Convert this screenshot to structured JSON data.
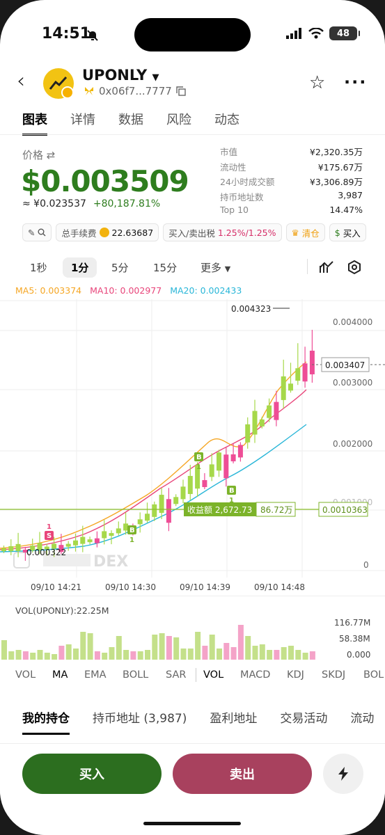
{
  "status_bar": {
    "time": "14:51",
    "battery": "48"
  },
  "header": {
    "token_name": "UPONLY",
    "address": "0x06f7...7777"
  },
  "tabs": [
    "图表",
    "详情",
    "数据",
    "风险",
    "动态"
  ],
  "price": {
    "label": "价格",
    "value": "$0.003509",
    "cny": "≈ ¥0.023537",
    "change": "+80,187.81%"
  },
  "stats": [
    {
      "k": "市值",
      "v": "¥2,320.35万"
    },
    {
      "k": "流动性",
      "v": "¥175.67万"
    },
    {
      "k": "24小时成交额",
      "v": "¥3,306.89万"
    },
    {
      "k": "持币地址数",
      "v": "3,987"
    },
    {
      "k": "Top 10",
      "v": "14.47%"
    }
  ],
  "chips": {
    "fee_label": "总手续费",
    "fee_value": "22.63687",
    "tax_label": "买入/卖出税",
    "tax_value": "1.25%/1.25%",
    "clear_label": "清仓",
    "buy_label": "买入"
  },
  "timeframes": [
    "1秒",
    "1分",
    "5分",
    "15分",
    "更多"
  ],
  "ma_legend": {
    "ma5": "MA5: 0.003374",
    "ma10": "MA10: 0.002977",
    "ma20": "MA20: 0.002433",
    "colors": {
      "ma5": "#f5a623",
      "ma10": "#e8457a",
      "ma20": "#29b6d8"
    }
  },
  "chart_data": {
    "type": "candlestick",
    "y_ticks": [
      "0.004000",
      "0.003000",
      "0.002000",
      "0",
      "0"
    ],
    "x_ticks": [
      "09/10 14:21",
      "09/10 14:30",
      "09/10 14:39",
      "09/10 14:48"
    ],
    "annotations": {
      "high": "0.004323",
      "low": "0.000322",
      "current_price": "0.003407",
      "avg_cost": "0.0010363",
      "profit_label": "收益额 2,672.73",
      "profit_value": "86.72万",
      "watermark": "DEX"
    },
    "markers": {
      "buy": "B",
      "sell": "S",
      "count": "1"
    }
  },
  "volume": {
    "title": "VOL(UPONLY):22.25M",
    "ticks": [
      "116.77M",
      "58.38M",
      "0.000"
    ]
  },
  "indicators": [
    "VOL",
    "MA",
    "EMA",
    "BOLL",
    "SAR",
    "VOL",
    "MACD",
    "KDJ",
    "SKDJ",
    "BOL"
  ],
  "holdings_tabs": [
    "我的持仓",
    "持币地址 (3,987)",
    "盈利地址",
    "交易活动",
    "流动"
  ],
  "actions": {
    "buy": "买入",
    "sell": "卖出"
  }
}
